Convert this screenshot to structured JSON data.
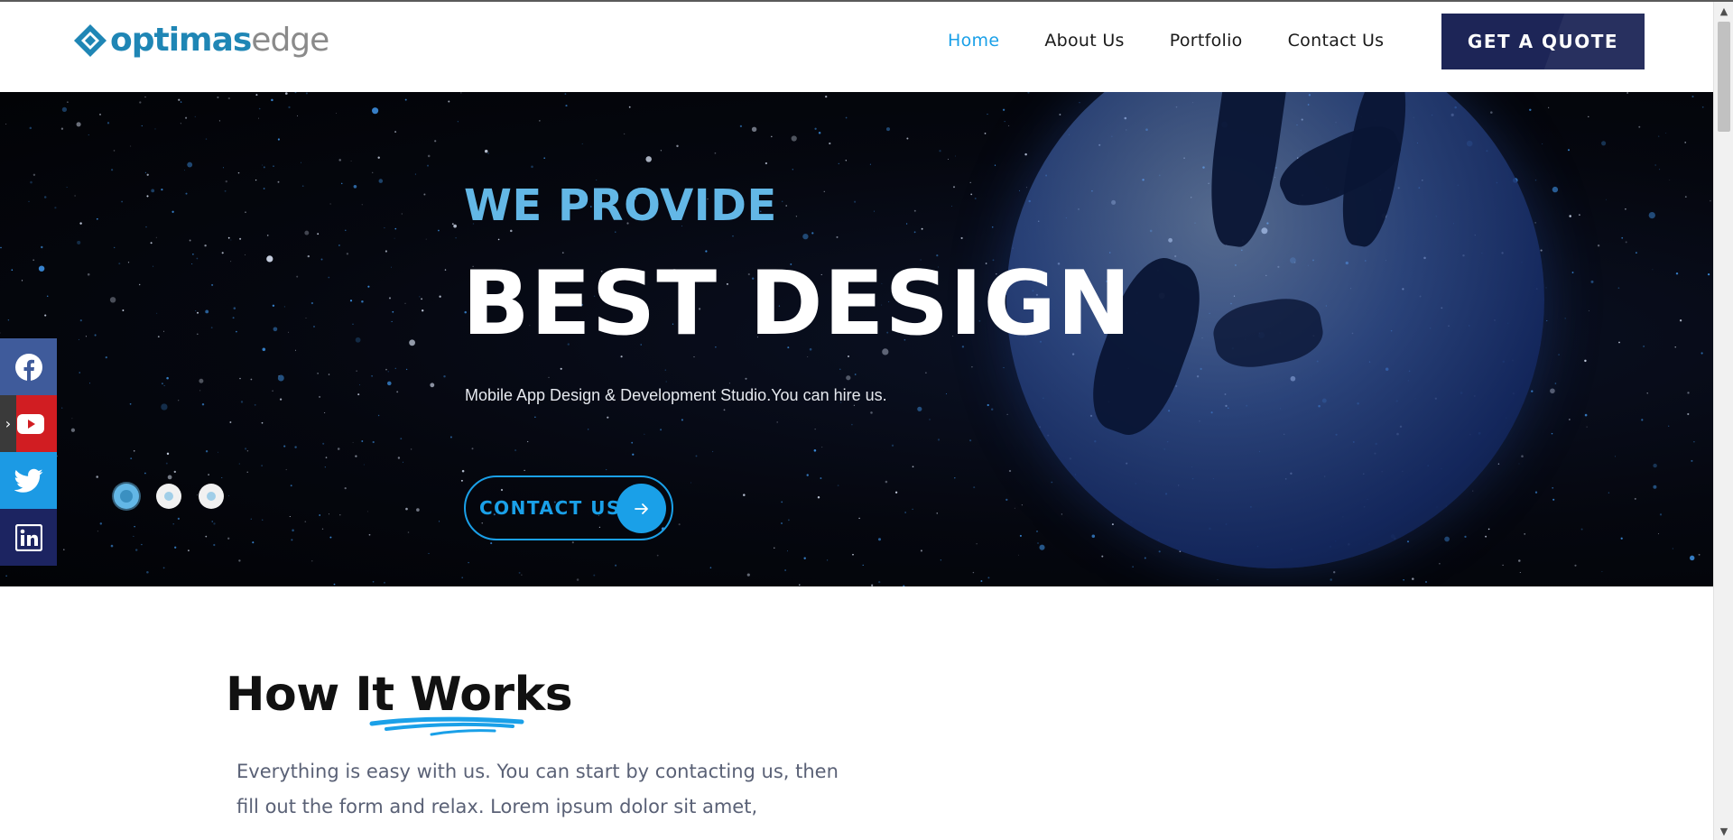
{
  "header": {
    "logo_bold": "optimas",
    "logo_light": "edge",
    "nav": [
      {
        "label": "Home",
        "active": true
      },
      {
        "label": "About Us",
        "active": false
      },
      {
        "label": "Portfolio",
        "active": false
      },
      {
        "label": "Contact Us",
        "active": false
      }
    ],
    "quote_button": "GET A QUOTE"
  },
  "hero": {
    "subtitle": "WE PROVIDE",
    "title": "BEST DESIGN",
    "description": "Mobile App Design & Development Studio.You can hire us.",
    "cta_label": "CONTACT US",
    "cta_icon": "arrow-right-icon",
    "slides": 3,
    "active_slide": 1
  },
  "social": [
    {
      "name": "facebook",
      "icon": "facebook-icon",
      "color": "#3f5b9b"
    },
    {
      "name": "youtube",
      "icon": "youtube-icon",
      "color": "#d11d22"
    },
    {
      "name": "twitter",
      "icon": "twitter-icon",
      "color": "#1c9ae4"
    },
    {
      "name": "linkedin",
      "icon": "linkedin-icon",
      "color": "#1c2461"
    }
  ],
  "works": {
    "title": "How It Works",
    "text_line1": "Everything is easy with us. You can start by contacting us, then",
    "text_line2": "fill out the form and relax. Lorem ipsum dolor sit amet,"
  },
  "colors": {
    "accent": "#1aa0e8",
    "navy": "#1d2557",
    "hero_subtitle": "#63b7e6"
  }
}
